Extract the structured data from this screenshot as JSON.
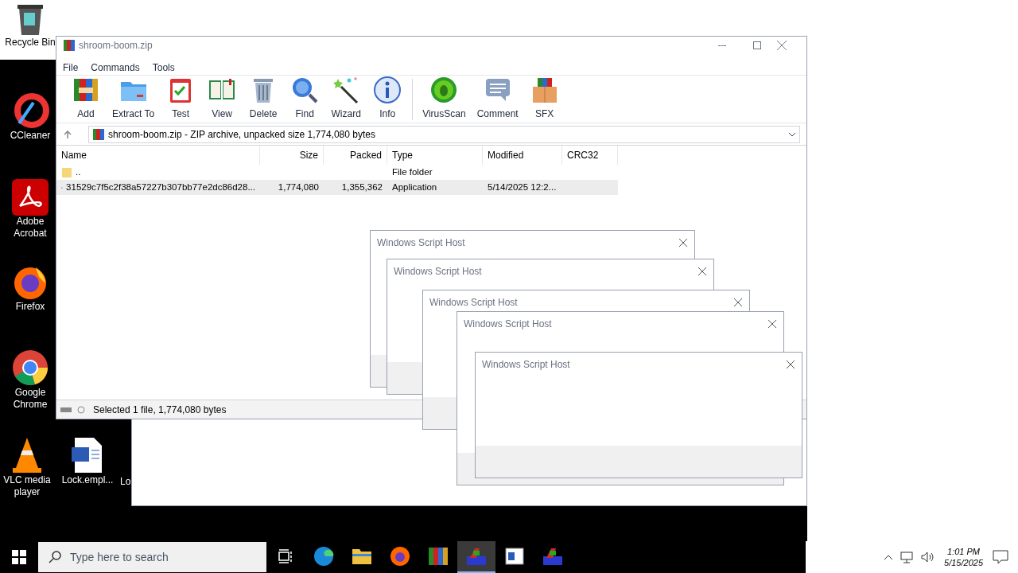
{
  "desktop_icons": [
    {
      "label": "Recycle Bin",
      "kind": "bin"
    },
    {
      "label": "CCleaner",
      "kind": "ccleaner"
    },
    {
      "label": "Adobe Acrobat",
      "kind": "acrobat"
    },
    {
      "label": "Firefox",
      "kind": "firefox"
    },
    {
      "label": "Google Chrome",
      "kind": "chrome"
    },
    {
      "label": "VLC media player",
      "kind": "vlc"
    },
    {
      "label": "Lock.empl...",
      "kind": "word"
    },
    {
      "label": "Lo",
      "kind": "cut"
    }
  ],
  "window": {
    "title": "shroom-boom.zip",
    "menu": [
      "File",
      "Commands",
      "Tools"
    ],
    "toolbar": [
      {
        "label": "Add",
        "kind": "add"
      },
      {
        "label": "Extract To",
        "kind": "extract"
      },
      {
        "label": "Test",
        "kind": "test"
      },
      {
        "label": "View",
        "kind": "view"
      },
      {
        "label": "Delete",
        "kind": "delete"
      },
      {
        "label": "Find",
        "kind": "find"
      },
      {
        "label": "Wizard",
        "kind": "wizard"
      },
      {
        "label": "Info",
        "kind": "info"
      },
      {
        "label": "VirusScan",
        "kind": "virus"
      },
      {
        "label": "Comment",
        "kind": "comment"
      },
      {
        "label": "SFX",
        "kind": "sfx"
      }
    ],
    "address": "shroom-boom.zip - ZIP archive, unpacked size 1,774,080 bytes",
    "table": {
      "columns": [
        "Name",
        "Size",
        "Packed",
        "Type",
        "Modified",
        "CRC32"
      ],
      "rows": [
        {
          "kind": "folder",
          "selected": false,
          "cells": [
            "..",
            "",
            "",
            "File folder",
            "",
            ""
          ]
        },
        {
          "kind": "app",
          "selected": true,
          "cells": [
            "31529c7f5c2f38a57227b307bb77e2dc86d28...",
            "1,774,080",
            "1,355,362",
            "Application",
            "5/14/2025 12:2...",
            ""
          ]
        }
      ]
    },
    "status_bar": "Selected 1 file, 1,774,080 bytes"
  },
  "dialogs": [
    {
      "title": "Windows Script Host"
    },
    {
      "title": "Windows Script Host"
    },
    {
      "title": "Windows Script Host"
    },
    {
      "title": "Windows Script Host"
    },
    {
      "title": "Windows Script Host"
    }
  ],
  "taskbar": {
    "search": {
      "placeholder": "Type here to search"
    },
    "apps": [
      {
        "kind": "taskview",
        "selected": false
      },
      {
        "kind": "edge",
        "selected": false
      },
      {
        "kind": "explorer",
        "selected": false
      },
      {
        "kind": "firefox",
        "selected": false
      },
      {
        "kind": "winrar",
        "selected": false
      },
      {
        "kind": "script",
        "selected": true
      },
      {
        "kind": "window",
        "selected": false
      },
      {
        "kind": "script",
        "selected": false
      }
    ],
    "time": "1:01 PM",
    "date": "5/15/2025"
  }
}
